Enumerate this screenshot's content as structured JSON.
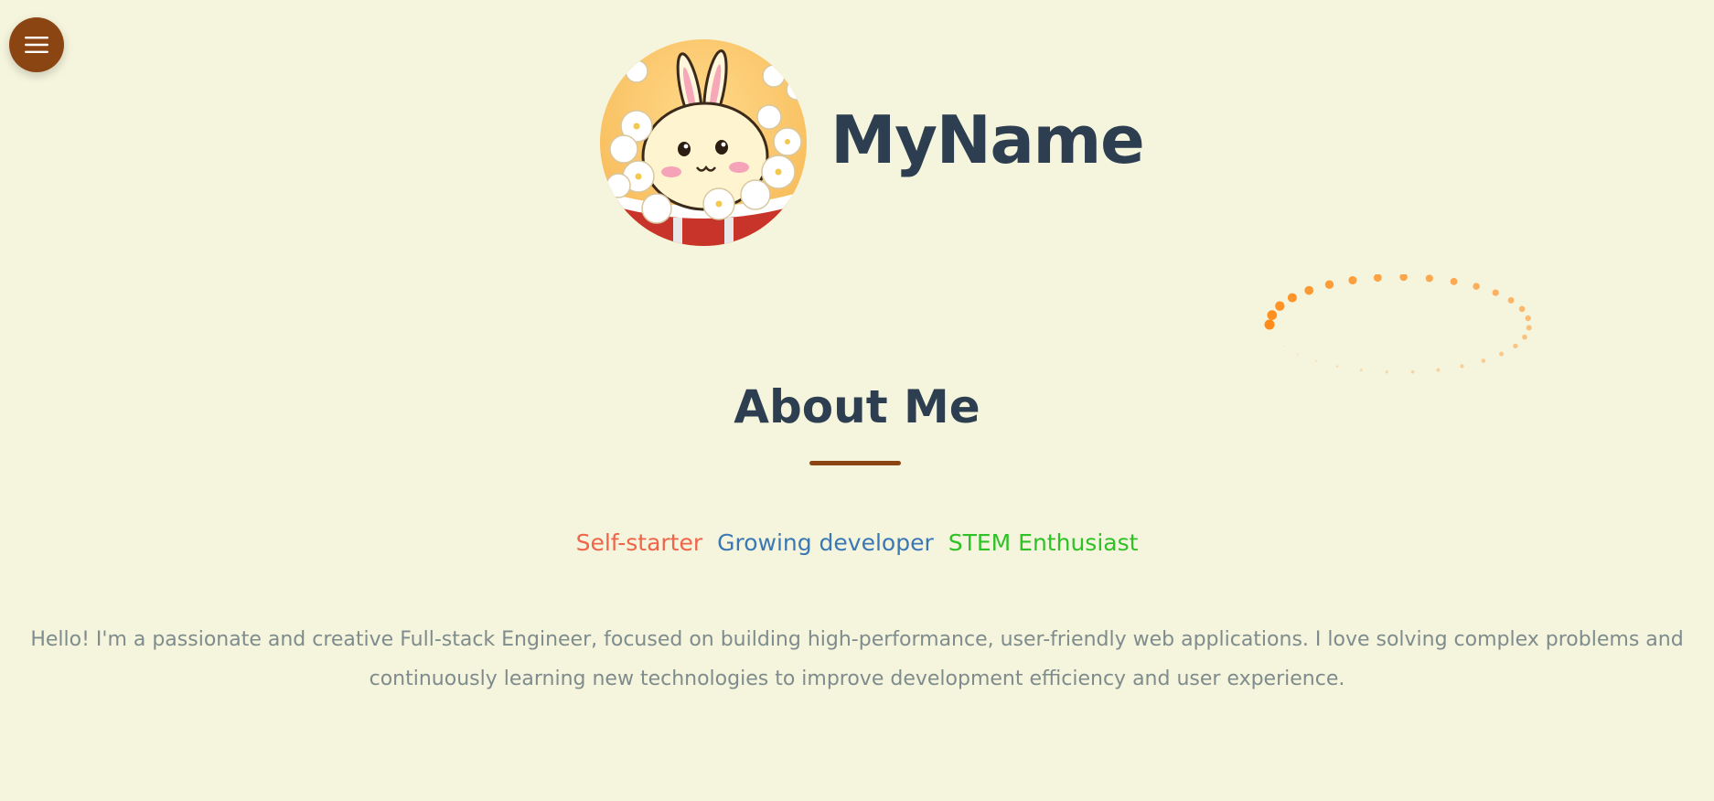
{
  "nav": {
    "menu_icon": "hamburger-menu-icon"
  },
  "header": {
    "avatar_alt": "bunny-in-popcorn-bucket",
    "name": "MyName"
  },
  "about": {
    "title": "About Me",
    "tags": [
      {
        "label": "Self-starter",
        "color": "#f0644a"
      },
      {
        "label": "Growing developer",
        "color": "#3a78b5"
      },
      {
        "label": "STEM Enthusiast",
        "color": "#2ec227"
      }
    ],
    "intro": "Hello! I'm a passionate and creative Full-stack Engineer, focused on building high-performance, user-friendly web applications. I love solving complex problems and continuously learning new technologies to improve development efficiency and user experience."
  },
  "colors": {
    "background": "#f5f4dc",
    "accent": "#8b4513",
    "heading": "#2c3e50",
    "body_text": "#7f8c8d",
    "spinner": "#ff8c1a"
  }
}
